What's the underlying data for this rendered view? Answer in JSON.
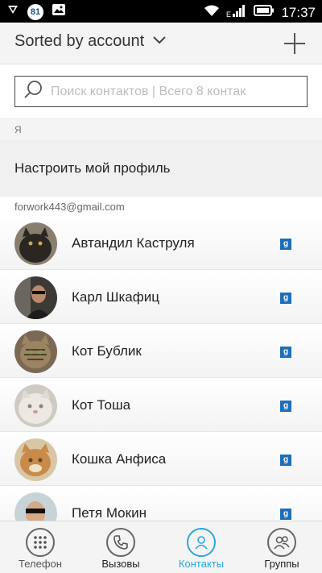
{
  "status_bar": {
    "notification_badge": "81",
    "time": "17:37",
    "network_label": "E",
    "icons": [
      "vpn-shield-icon",
      "gallery-icon",
      "wifi-icon",
      "signal-icon",
      "battery-icon"
    ]
  },
  "app_bar": {
    "sort_label": "Sorted by account",
    "sort_icon": "chevron-down-icon",
    "add_icon": "plus-icon"
  },
  "search": {
    "placeholder": "Поиск контактов | Всего 8 контак",
    "value": ""
  },
  "me_section": {
    "header": "Я",
    "profile_label": "Настроить мой профиль"
  },
  "account": {
    "email": "forwork443@gmail.com"
  },
  "contacts": [
    {
      "name": "Автандил Каструля",
      "avatar": "black-cat",
      "source_badge": "g"
    },
    {
      "name": "Карл Шкафиц",
      "avatar": "man-in-car",
      "source_badge": "g"
    },
    {
      "name": "Кот Бублик",
      "avatar": "tabby-cat",
      "source_badge": "g"
    },
    {
      "name": "Кот Тоша",
      "avatar": "white-persian-cat",
      "source_badge": "g"
    },
    {
      "name": "Кошка Анфиса",
      "avatar": "ginger-cat",
      "source_badge": "g"
    },
    {
      "name": "Петя Мокин",
      "avatar": "man-with-sunglasses",
      "source_badge": "g"
    }
  ],
  "bottom_nav": [
    {
      "label": "Телефон",
      "icon": "dialpad-icon",
      "active": false
    },
    {
      "label": "Вызовы",
      "icon": "phone-icon",
      "active": false
    },
    {
      "label": "Контакты",
      "icon": "person-icon",
      "active": true
    },
    {
      "label": "Группы",
      "icon": "group-icon",
      "active": false
    }
  ],
  "colors": {
    "accent": "#29a8de",
    "google_badge": "#1c6fb8",
    "status_bar": "#000000"
  }
}
